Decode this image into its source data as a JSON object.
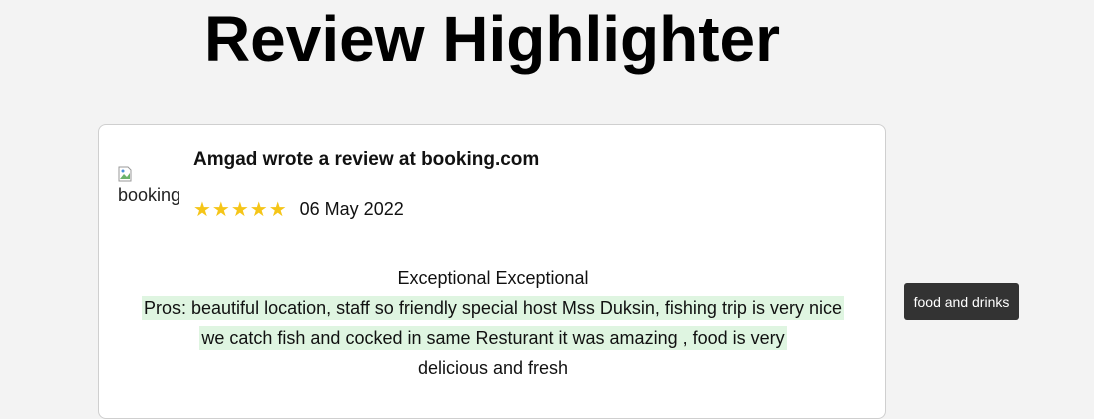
{
  "page": {
    "title": "Review Highlighter"
  },
  "review": {
    "logo_alt": "booking",
    "header": "Amgad wrote a review at booking.com",
    "stars": "★★★★★",
    "date": "06 May 2022",
    "title_line": "Exceptional Exceptional",
    "highlight_line1": "Pros: beautiful location, staff so friendly special host Mss Duksin, fishing trip is very nice",
    "highlight_line2": "we catch fish and cocked in same Resturant it was amazing , food is very",
    "plain_tail": "delicious and fresh"
  },
  "tooltip": {
    "label": "food and drinks"
  },
  "colors": {
    "background": "#f3f3f3",
    "highlight": "#dff5e1",
    "star": "#f5c518",
    "tooltip_bg": "#333333"
  }
}
